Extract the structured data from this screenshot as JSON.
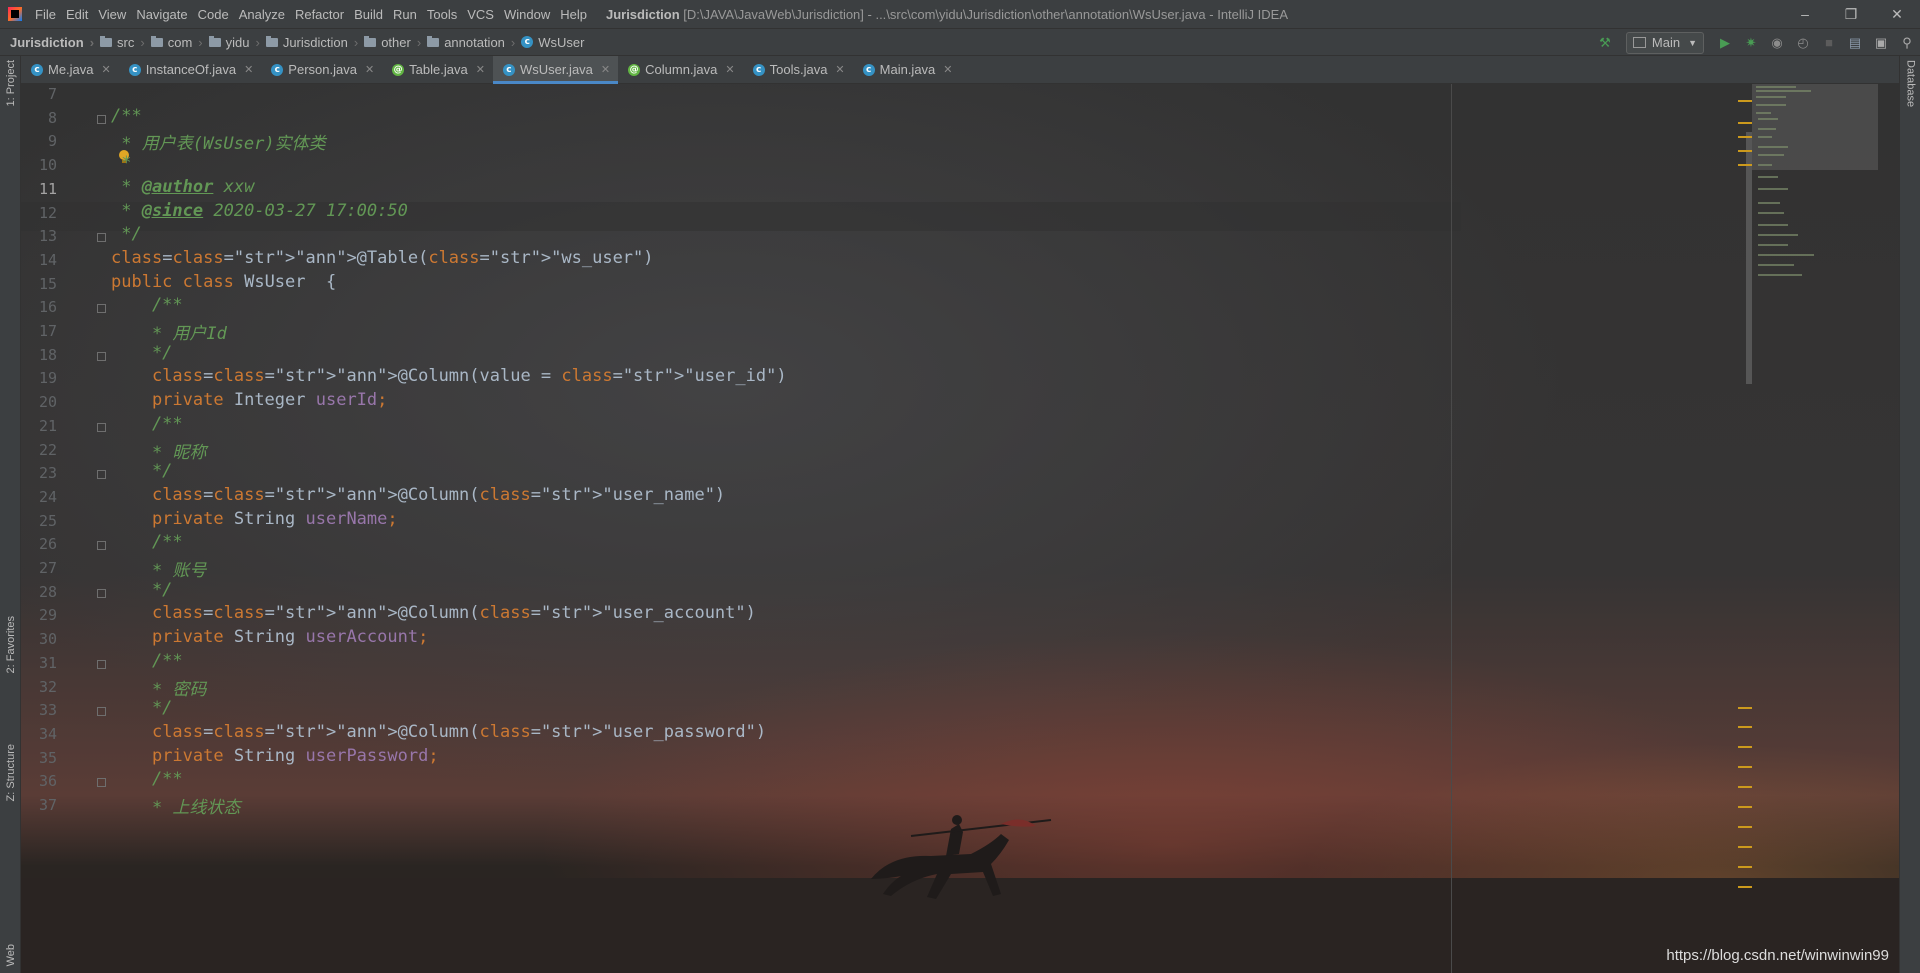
{
  "window": {
    "title_project": "Jurisdiction",
    "title_rest": "[D:\\JAVA\\JavaWeb\\Jurisdiction] - ...\\src\\com\\yidu\\Jurisdiction\\other\\annotation\\WsUser.java - IntelliJ IDEA"
  },
  "menu": [
    "File",
    "Edit",
    "View",
    "Navigate",
    "Code",
    "Analyze",
    "Refactor",
    "Build",
    "Run",
    "Tools",
    "VCS",
    "Window",
    "Help"
  ],
  "breadcrumb": [
    {
      "label": "Jurisdiction",
      "type": "project"
    },
    {
      "label": "src",
      "type": "folder"
    },
    {
      "label": "com",
      "type": "folder"
    },
    {
      "label": "yidu",
      "type": "folder"
    },
    {
      "label": "Jurisdiction",
      "type": "folder"
    },
    {
      "label": "other",
      "type": "folder"
    },
    {
      "label": "annotation",
      "type": "folder"
    },
    {
      "label": "WsUser",
      "type": "class"
    }
  ],
  "run_config": "Main",
  "tabs": [
    {
      "label": "Me.java",
      "icon": "class-icon",
      "active": false
    },
    {
      "label": "InstanceOf.java",
      "icon": "class-icon",
      "active": false
    },
    {
      "label": "Person.java",
      "icon": "class-icon",
      "active": false
    },
    {
      "label": "Table.java",
      "icon": "annotation-icon",
      "active": false
    },
    {
      "label": "WsUser.java",
      "icon": "class-icon",
      "active": true
    },
    {
      "label": "Column.java",
      "icon": "annotation-icon",
      "active": false
    },
    {
      "label": "Tools.java",
      "icon": "class-icon",
      "active": false
    },
    {
      "label": "Main.java",
      "icon": "class-icon",
      "active": false
    }
  ],
  "left_tool_windows": [
    "1: Project",
    "2: Favorites",
    "Z: Structure",
    "Web"
  ],
  "right_tool_windows": [
    "Database"
  ],
  "current_line": 11,
  "code_lines": [
    {
      "n": "7",
      "text": ""
    },
    {
      "n": "8",
      "text": "/**"
    },
    {
      "n": "9",
      "text": " * 用户表(WsUser)实体类"
    },
    {
      "n": "10",
      "text": " *"
    },
    {
      "n": "11",
      "text": " * @author xxw"
    },
    {
      "n": "12",
      "text": " * @since 2020-03-27 17:00:50"
    },
    {
      "n": "13",
      "text": " */"
    },
    {
      "n": "14",
      "text": "@Table(\"ws_user\")"
    },
    {
      "n": "15",
      "text": "public class WsUser  {"
    },
    {
      "n": "16",
      "text": "    /**"
    },
    {
      "n": "17",
      "text": "    * 用户Id"
    },
    {
      "n": "18",
      "text": "    */"
    },
    {
      "n": "19",
      "text": "    @Column(value = \"user_id\")"
    },
    {
      "n": "20",
      "text": "    private Integer userId;"
    },
    {
      "n": "21",
      "text": "    /**"
    },
    {
      "n": "22",
      "text": "    * 昵称"
    },
    {
      "n": "23",
      "text": "    */"
    },
    {
      "n": "24",
      "text": "    @Column(\"user_name\")"
    },
    {
      "n": "25",
      "text": "    private String userName;"
    },
    {
      "n": "26",
      "text": "    /**"
    },
    {
      "n": "27",
      "text": "    * 账号"
    },
    {
      "n": "28",
      "text": "    */"
    },
    {
      "n": "29",
      "text": "    @Column(\"user_account\")"
    },
    {
      "n": "30",
      "text": "    private String userAccount;"
    },
    {
      "n": "31",
      "text": "    /**"
    },
    {
      "n": "32",
      "text": "    * 密码"
    },
    {
      "n": "33",
      "text": "    */"
    },
    {
      "n": "34",
      "text": "    @Column(\"user_password\")"
    },
    {
      "n": "35",
      "text": "    private String userPassword;"
    },
    {
      "n": "36",
      "text": "    /**"
    },
    {
      "n": "37",
      "text": "    * 上线状态"
    }
  ],
  "watermark": "https://blog.csdn.net/winwinwin99",
  "colors": {
    "keyword": "#cc7832",
    "string": "#6a8759",
    "annotation": "#bbb529",
    "comment": "#629755",
    "field": "#9876aa",
    "text": "#a9b7c6"
  }
}
